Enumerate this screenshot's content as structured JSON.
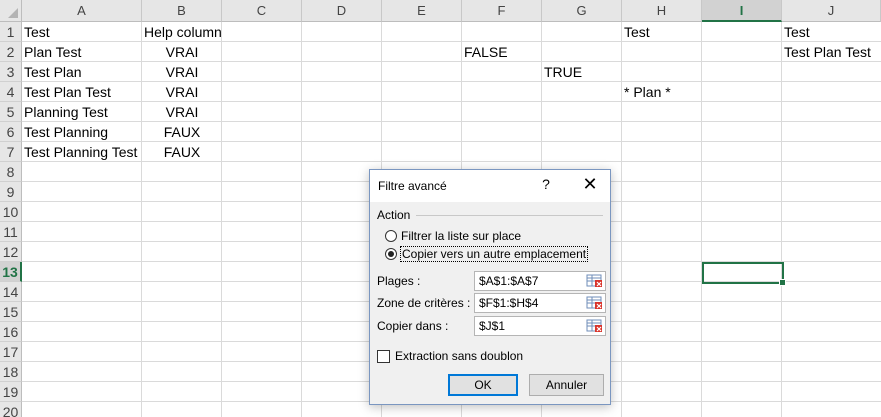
{
  "columns": [
    "A",
    "B",
    "C",
    "D",
    "E",
    "F",
    "G",
    "H",
    "I",
    "J"
  ],
  "rows": [
    "1",
    "2",
    "3",
    "4",
    "5",
    "6",
    "7",
    "8",
    "9",
    "10",
    "11",
    "12",
    "13",
    "14",
    "15",
    "16",
    "17",
    "18",
    "19",
    "20"
  ],
  "selected_column": "I",
  "selected_row": "13",
  "cells": [
    {
      "col": "A",
      "row": 1,
      "text": "Test"
    },
    {
      "col": "B",
      "row": 1,
      "text": "Help column"
    },
    {
      "col": "H",
      "row": 1,
      "text": "Test"
    },
    {
      "col": "J",
      "row": 1,
      "text": "Test"
    },
    {
      "col": "A",
      "row": 2,
      "text": "Plan Test"
    },
    {
      "col": "B",
      "row": 2,
      "text": "VRAI",
      "align": "center"
    },
    {
      "col": "F",
      "row": 2,
      "text": "FALSE"
    },
    {
      "col": "J",
      "row": 2,
      "text": "Test Plan Test"
    },
    {
      "col": "A",
      "row": 3,
      "text": "Test Plan"
    },
    {
      "col": "B",
      "row": 3,
      "text": "VRAI",
      "align": "center"
    },
    {
      "col": "G",
      "row": 3,
      "text": "TRUE"
    },
    {
      "col": "A",
      "row": 4,
      "text": "Test Plan Test"
    },
    {
      "col": "B",
      "row": 4,
      "text": "VRAI",
      "align": "center"
    },
    {
      "col": "H",
      "row": 4,
      "text": "* Plan *"
    },
    {
      "col": "A",
      "row": 5,
      "text": "Planning Test"
    },
    {
      "col": "B",
      "row": 5,
      "text": "VRAI",
      "align": "center"
    },
    {
      "col": "A",
      "row": 6,
      "text": "Test Planning"
    },
    {
      "col": "B",
      "row": 6,
      "text": "FAUX",
      "align": "center"
    },
    {
      "col": "A",
      "row": 7,
      "text": "Test Planning Test"
    },
    {
      "col": "B",
      "row": 7,
      "text": "FAUX",
      "align": "center"
    }
  ],
  "dialog": {
    "title": "Filtre avancé",
    "help": "?",
    "close": "✕",
    "action_label": "Action",
    "option_filter": "Filtrer la liste sur place",
    "option_copy": "Copier vers un autre emplacement",
    "selected_option": "copy",
    "range_label": "Plages :",
    "range_value": "$A$1:$A$7",
    "criteria_label": "Zone de critères :",
    "criteria_value": "$F$1:$H$4",
    "copy_to_label": "Copier dans :",
    "copy_to_value": "$J$1",
    "unique_label": "Extraction sans doublon",
    "unique_checked": false,
    "ok": "OK",
    "cancel": "Annuler"
  }
}
